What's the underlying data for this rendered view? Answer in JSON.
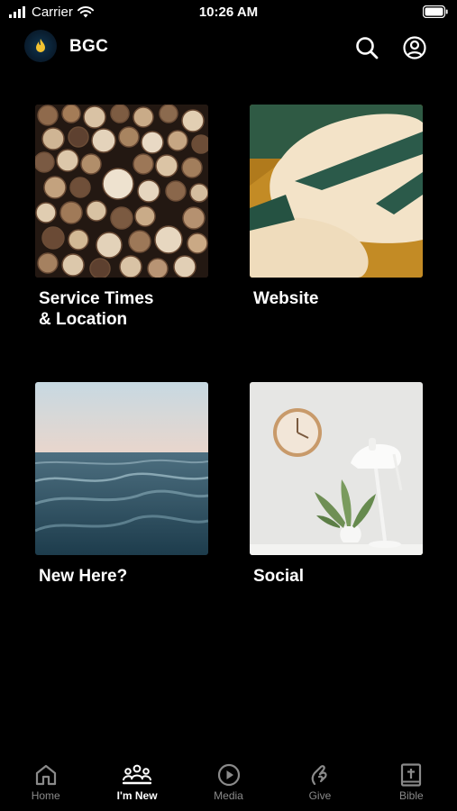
{
  "status_bar": {
    "carrier": "Carrier",
    "time": "10:26 AM"
  },
  "header": {
    "title": "BGC"
  },
  "tiles": [
    {
      "label": "Service Times\n& Location",
      "image": "cut logs photo"
    },
    {
      "label": "Website",
      "image": "modern chairs photo"
    },
    {
      "label": "New Here?",
      "image": "ocean waves photo"
    },
    {
      "label": "Social",
      "image": "clock, plant and lamp photo"
    }
  ],
  "tabbar": {
    "tabs": [
      {
        "label": "Home",
        "icon": "home-icon"
      },
      {
        "label": "I'm New",
        "icon": "people-icon",
        "active": true
      },
      {
        "label": "Media",
        "icon": "play-icon"
      },
      {
        "label": "Give",
        "icon": "give-icon"
      },
      {
        "label": "Bible",
        "icon": "bible-icon"
      }
    ]
  },
  "colors": {
    "background": "#000000",
    "text": "#ffffff",
    "inactive_tab": "#8a8a8a",
    "logo_flame": "#f2c230"
  }
}
